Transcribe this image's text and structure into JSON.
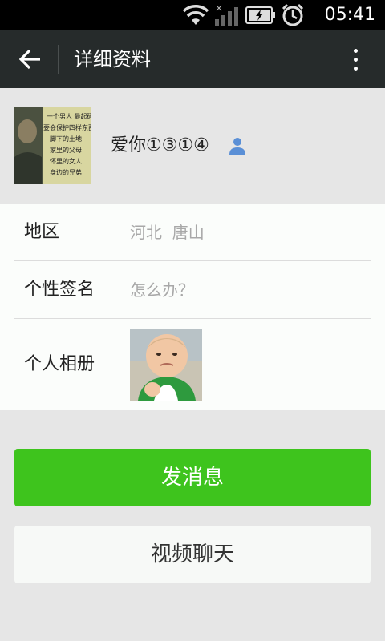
{
  "status_bar": {
    "time": "05:41",
    "icons": [
      "wifi-icon",
      "signal-icon",
      "battery-icon",
      "alarm-icon"
    ]
  },
  "header": {
    "title": "详细资料",
    "back_icon": "back-arrow-icon",
    "more_icon": "more-vertical-icon"
  },
  "profile": {
    "nickname": "爱你①③①④",
    "gender_icon": "user-icon",
    "avatar_lines": [
      "一个男人 最起码",
      "要会保护四样东西",
      "脚下的土地",
      "家里的父母",
      "怀里的女人",
      "身边的兄弟"
    ]
  },
  "details": {
    "region_label": "地区",
    "region_value": "河北  唐山",
    "signature_label": "个性签名",
    "signature_value": "怎么办？",
    "album_label": "个人相册"
  },
  "actions": {
    "send_message": "发消息",
    "video_chat": "视频聊天"
  },
  "colors": {
    "header_bg": "#262b2b",
    "accent_green": "#3ec41d",
    "page_bg": "#e6e6e6"
  }
}
